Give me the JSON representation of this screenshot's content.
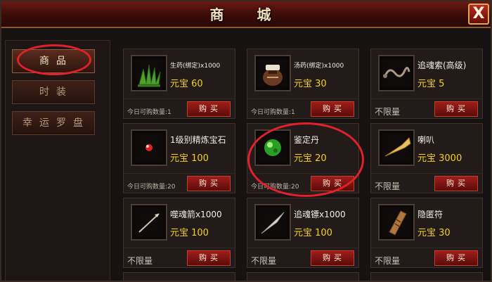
{
  "window": {
    "title": "商 城",
    "close_label": "X"
  },
  "categories": [
    {
      "label": "商品",
      "active": true
    },
    {
      "label": "时装",
      "active": false
    },
    {
      "label": "幸运罗盘",
      "active": false
    }
  ],
  "items": [
    {
      "name": "生药(绑定)x1000",
      "price": "元宝 60",
      "limit": "今日可购数量:1",
      "buy": "购买",
      "icon": "herb-icon"
    },
    {
      "name": "汤药(绑定)x1000",
      "price": "元宝 30",
      "limit": "今日可购数量:1",
      "buy": "购买",
      "icon": "potion-pot-icon"
    },
    {
      "name": "追魂索(高级)",
      "price": "元宝 5",
      "limit": "不限量",
      "buy": "购买",
      "icon": "rope-icon"
    },
    {
      "name": "1级别精炼宝石",
      "price": "元宝 100",
      "limit": "今日可购数量:20",
      "buy": "购买",
      "icon": "red-gem-icon"
    },
    {
      "name": "鉴定丹",
      "price": "元宝 20",
      "limit": "今日可购数量:20",
      "buy": "购买",
      "icon": "green-pill-icon"
    },
    {
      "name": "喇叭",
      "price": "元宝 3000",
      "limit": "不限量",
      "buy": "购买",
      "icon": "horn-icon"
    },
    {
      "name": "噬魂箭x1000",
      "price": "元宝 100",
      "limit": "不限量",
      "buy": "购买",
      "icon": "arrow-icon"
    },
    {
      "name": "追魂镖x1000",
      "price": "元宝 100",
      "limit": "不限量",
      "buy": "购买",
      "icon": "dart-icon"
    },
    {
      "name": "隐匿符",
      "price": "元宝 30",
      "limit": "不限量",
      "buy": "购买",
      "icon": "talisman-icon"
    }
  ]
}
